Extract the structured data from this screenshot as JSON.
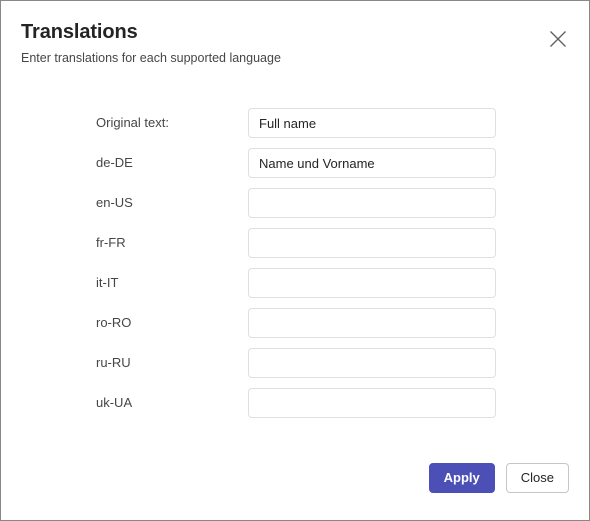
{
  "dialog": {
    "title": "Translations",
    "subtitle": "Enter translations for each supported language",
    "close_icon": "close-icon"
  },
  "form": {
    "rows": [
      {
        "label": "Original text:",
        "value": "Full name",
        "placeholder": ""
      },
      {
        "label": "de-DE",
        "value": "Name und Vorname",
        "placeholder": ""
      },
      {
        "label": "en-US",
        "value": "",
        "placeholder": ""
      },
      {
        "label": "fr-FR",
        "value": "",
        "placeholder": ""
      },
      {
        "label": "it-IT",
        "value": "",
        "placeholder": ""
      },
      {
        "label": "ro-RO",
        "value": "",
        "placeholder": ""
      },
      {
        "label": "ru-RU",
        "value": "",
        "placeholder": ""
      },
      {
        "label": "uk-UA",
        "value": "",
        "placeholder": ""
      }
    ]
  },
  "footer": {
    "apply_label": "Apply",
    "close_label": "Close"
  },
  "colors": {
    "accent": "#4b4fb6",
    "dialog_border": "#8a8886",
    "input_border": "#e1dfdd",
    "title_text": "#252423",
    "label_text": "#484644"
  }
}
